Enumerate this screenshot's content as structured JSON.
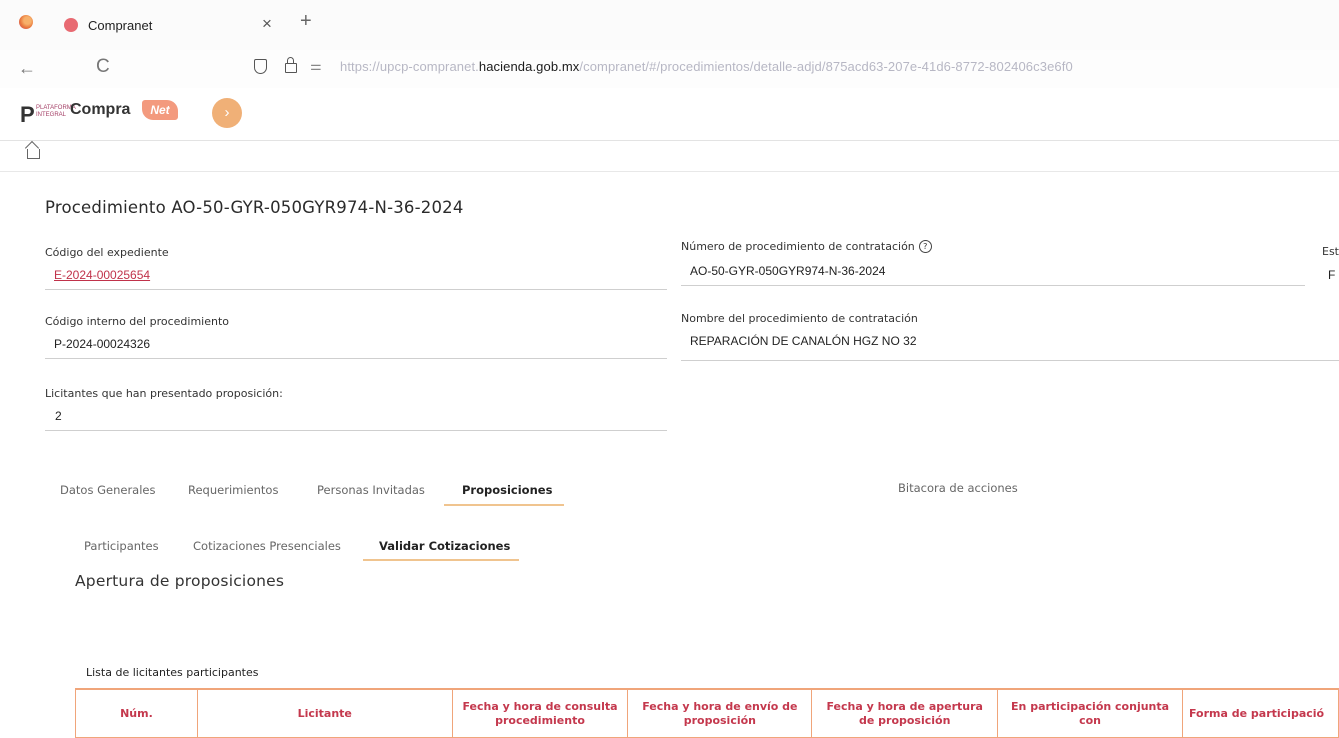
{
  "browser": {
    "tab_title": "Compranet",
    "tab_close": "×",
    "new_tab": "+",
    "back_icon": "←",
    "reload_icon": "C",
    "url_prefix": "https://upcp-compranet.",
    "url_host": "hacienda.gob.mx",
    "url_path": "/compranet/#/procedimientos/detalle-adjd/875acd63-207e-41d6-8772-802406c3e6f0"
  },
  "app_header": {
    "logo_p": "P",
    "logo_small_1": "PLATAFORMA",
    "logo_small_2": "INTEGRAL",
    "logo_compra": "Compra",
    "logo_net": "Net",
    "collapse_icon": "›"
  },
  "procedure": {
    "title": "Procedimiento AO-50-GYR-050GYR974-N-36-2024",
    "fields": {
      "expediente_label": "Código del expediente",
      "expediente_value": "E-2024-00025654",
      "numero_label": "Número de procedimiento de contratación",
      "numero_value": "AO-50-GYR-050GYR974-N-36-2024",
      "estatus_label": "Est",
      "estatus_value": "F",
      "interno_label": "Código interno del procedimiento",
      "interno_value": "P-2024-00024326",
      "nombre_label": "Nombre del procedimiento de contratación",
      "nombre_value": "REPARACIÓN DE CANALÓN HGZ NO 32",
      "licitantes_label": "Licitantes que han presentado proposición:",
      "licitantes_value": "2"
    }
  },
  "main_tabs": [
    "Datos Generales",
    "Requerimientos",
    "Personas Invitadas",
    "Proposiciones",
    "Bitacora de acciones"
  ],
  "sub_tabs": [
    "Participantes",
    "Cotizaciones Presenciales",
    "Validar Cotizaciones"
  ],
  "section_title": "Apertura de proposiciones",
  "list_title": "Lista de licitantes participantes",
  "table": {
    "headers": [
      "Núm.",
      "Licitante",
      "Fecha y hora de consulta procedimiento",
      "Fecha y hora de envío de proposición",
      "Fecha y hora de apertura de proposición",
      "En participación conjunta con",
      "Forma de participació"
    ]
  }
}
